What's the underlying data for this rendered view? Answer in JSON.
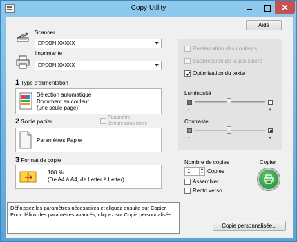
{
  "window": {
    "title": "Copy Utility"
  },
  "toolbar": {
    "help_label": "Aide"
  },
  "scanner": {
    "label": "Scanner",
    "selected": "EPSON XXXXX"
  },
  "printer": {
    "label": "Imprimante",
    "selected": "EPSON XXXXX"
  },
  "step1": {
    "number": "1",
    "label": "Type d'alimentation",
    "lines": [
      "Sélection automatique",
      "Document en couleur",
      "(une seule page)"
    ]
  },
  "step2": {
    "number": "2",
    "label": "Sortie papier",
    "option_line1": "Paramètre",
    "option_line2": "d'impression facile",
    "value": "Paramètres Papier"
  },
  "step3": {
    "number": "3",
    "label": "Format de copie",
    "line1": "100 %",
    "line2": "(De A4 à A4, de Letter à Letter)"
  },
  "options": {
    "restore_colors": {
      "label": "Restauration des couleurs",
      "checked": false
    },
    "dust_removal": {
      "label": "Suppression de la poussière",
      "checked": false
    },
    "text_opt": {
      "label": "Optimisation du texte",
      "checked": true
    }
  },
  "brightness": {
    "label": "Luminosité",
    "min_label": "-",
    "max_label": "+",
    "value_fraction": 0.5
  },
  "contrast": {
    "label": "Contraste",
    "min_label": "-",
    "max_label": "+",
    "value_fraction": 0.5
  },
  "copies": {
    "label": "Nombre de copies",
    "value": "1",
    "unit": "Copies",
    "assemble_label": "Assembler",
    "duplex_label": "Recto verso"
  },
  "copy_button": {
    "label": "Copier"
  },
  "status": {
    "text": "Définissez les paramètres nécessaires et cliquez ensuite sur Copier.  Pour définir des paramètres avancés, cliquez sur Copie personnalisée."
  },
  "custom_copy": {
    "label": "Copie personnalisée..."
  },
  "colors": {
    "accent_green": "#2a9a3d",
    "title_bar": "#6fb3dc",
    "close": "#c75050"
  }
}
